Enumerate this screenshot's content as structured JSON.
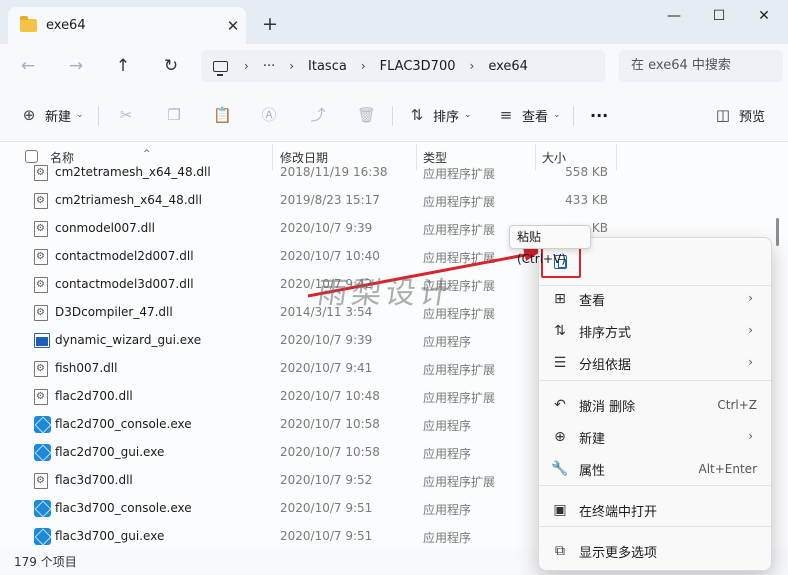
{
  "window": {
    "tab_title": "exe64",
    "tab_close": "✕",
    "new_tab": "+",
    "minimize": "—",
    "maximize": "☐",
    "close": "✕"
  },
  "nav": {
    "back": "←",
    "forward": "→",
    "up": "↑",
    "refresh": "↻",
    "breadcrumbs": [
      "Itasca",
      "FLAC3D700",
      "exe64"
    ],
    "more": "···",
    "search_placeholder": "在 exe64 中搜索"
  },
  "commands": {
    "new": "新建",
    "sort": "排序",
    "view": "查看",
    "more": "···",
    "preview": "预览"
  },
  "columns": {
    "name": "名称",
    "date": "修改日期",
    "type": "类型",
    "size": "大小"
  },
  "files": [
    {
      "name": "cm2tetramesh_x64_48.dll",
      "date": "2018/11/19 16:38",
      "type": "应用程序扩展",
      "size": "558 KB",
      "icon": "dll"
    },
    {
      "name": "cm2triamesh_x64_48.dll",
      "date": "2019/8/23 15:17",
      "type": "应用程序扩展",
      "size": "433 KB",
      "icon": "dll"
    },
    {
      "name": "conmodel007.dll",
      "date": "2020/10/7 9:39",
      "type": "应用程序扩展",
      "size": "KB",
      "icon": "dll"
    },
    {
      "name": "contactmodel2d007.dll",
      "date": "2020/10/7 10:40",
      "type": "应用程序扩展",
      "size": "",
      "icon": "dll"
    },
    {
      "name": "contactmodel3d007.dll",
      "date": "2020/10/7 9:42",
      "type": "应用程序扩展",
      "size": "",
      "icon": "dll"
    },
    {
      "name": "D3Dcompiler_47.dll",
      "date": "2014/3/11 3:54",
      "type": "应用程序扩展",
      "size": "",
      "icon": "dll"
    },
    {
      "name": "dynamic_wizard_gui.exe",
      "date": "2020/10/7 9:39",
      "type": "应用程序",
      "size": "",
      "icon": "exe"
    },
    {
      "name": "fish007.dll",
      "date": "2020/10/7 9:41",
      "type": "应用程序扩展",
      "size": "",
      "icon": "dll"
    },
    {
      "name": "flac2d700.dll",
      "date": "2020/10/7 10:48",
      "type": "应用程序扩展",
      "size": "",
      "icon": "dll"
    },
    {
      "name": "flac2d700_console.exe",
      "date": "2020/10/7 10:58",
      "type": "应用程序",
      "size": "",
      "icon": "flac"
    },
    {
      "name": "flac2d700_gui.exe",
      "date": "2020/10/7 10:58",
      "type": "应用程序",
      "size": "",
      "icon": "flac"
    },
    {
      "name": "flac3d700.dll",
      "date": "2020/10/7 9:52",
      "type": "应用程序扩展",
      "size": "",
      "icon": "dll"
    },
    {
      "name": "flac3d700_console.exe",
      "date": "2020/10/7 9:51",
      "type": "应用程序",
      "size": "",
      "icon": "flac"
    },
    {
      "name": "flac3d700_gui.exe",
      "date": "2020/10/7 9:51",
      "type": "应用程序",
      "size": "",
      "icon": "flac"
    }
  ],
  "status": {
    "item_count": "179 个项目"
  },
  "context_menu": {
    "paste_tooltip": "粘贴 (Ctrl+V)",
    "items": [
      {
        "label": "查看",
        "icon": "grid-icon",
        "glyph": "⊞",
        "submenu": true
      },
      {
        "label": "排序方式",
        "icon": "sort-icon",
        "glyph": "⇅",
        "submenu": true
      },
      {
        "label": "分组依据",
        "icon": "group-icon",
        "glyph": "☰",
        "submenu": true
      },
      {
        "label": "撤消 删除",
        "icon": "undo-icon",
        "glyph": "↶",
        "shortcut": "Ctrl+Z"
      },
      {
        "label": "新建",
        "icon": "new-icon",
        "glyph": "⊕",
        "submenu": true
      },
      {
        "label": "属性",
        "icon": "properties-icon",
        "glyph": "🔧",
        "shortcut": "Alt+Enter"
      },
      {
        "label": "在终端中打开",
        "icon": "terminal-icon",
        "glyph": "▣"
      },
      {
        "label": "显示更多选项",
        "icon": "more-options-icon",
        "glyph": "⧉"
      }
    ]
  },
  "watermark": "雨梨设计",
  "colors": {
    "accent": "#1f5fb6",
    "highlight_box": "#d9242b",
    "arrow": "#d9242b"
  }
}
